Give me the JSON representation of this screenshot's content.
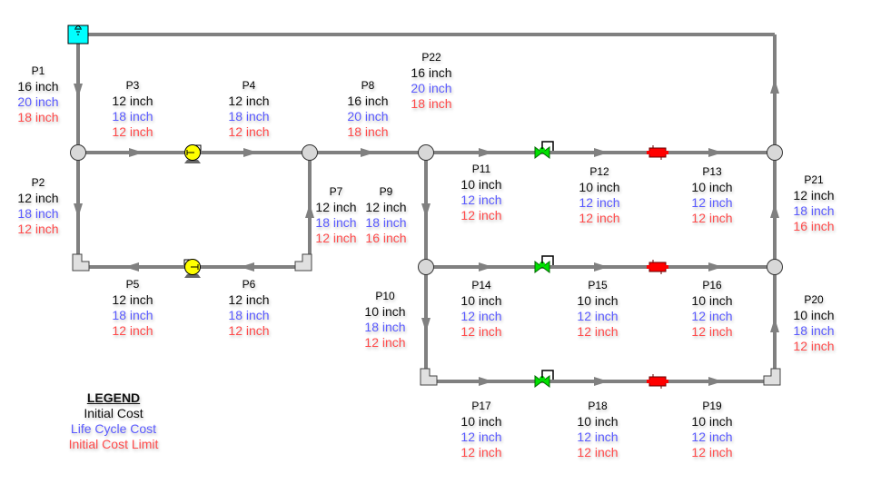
{
  "colors": {
    "pipe": "#808080",
    "initial_cost": "#111111",
    "life_cycle_cost": "#5a5aff",
    "initial_cost_limit": "#ff4a4a",
    "tank": "#00ffff",
    "pump": "#ffff00",
    "valve": "#00e000",
    "heat_exchanger": "#ff0000",
    "junction": "#d8d8d8"
  },
  "pipes": [
    {
      "name": "P1",
      "initial": "16 inch",
      "lcc": "20 inch",
      "limit": "18 inch"
    },
    {
      "name": "P2",
      "initial": "12 inch",
      "lcc": "18 inch",
      "limit": "12 inch"
    },
    {
      "name": "P3",
      "initial": "12 inch",
      "lcc": "18 inch",
      "limit": "12 inch"
    },
    {
      "name": "P4",
      "initial": "12 inch",
      "lcc": "18 inch",
      "limit": "12 inch"
    },
    {
      "name": "P5",
      "initial": "12 inch",
      "lcc": "18 inch",
      "limit": "12 inch"
    },
    {
      "name": "P6",
      "initial": "12 inch",
      "lcc": "18 inch",
      "limit": "12 inch"
    },
    {
      "name": "P7",
      "initial": "12 inch",
      "lcc": "18 inch",
      "limit": "12 inch"
    },
    {
      "name": "P8",
      "initial": "16 inch",
      "lcc": "20 inch",
      "limit": "18 inch"
    },
    {
      "name": "P9",
      "initial": "12 inch",
      "lcc": "18 inch",
      "limit": "16 inch"
    },
    {
      "name": "P10",
      "initial": "10 inch",
      "lcc": "18 inch",
      "limit": "12 inch"
    },
    {
      "name": "P11",
      "initial": "10 inch",
      "lcc": "12 inch",
      "limit": "12 inch"
    },
    {
      "name": "P12",
      "initial": "10 inch",
      "lcc": "12 inch",
      "limit": "12 inch"
    },
    {
      "name": "P13",
      "initial": "10 inch",
      "lcc": "12 inch",
      "limit": "12 inch"
    },
    {
      "name": "P14",
      "initial": "10 inch",
      "lcc": "12 inch",
      "limit": "12 inch"
    },
    {
      "name": "P15",
      "initial": "10 inch",
      "lcc": "12 inch",
      "limit": "12 inch"
    },
    {
      "name": "P16",
      "initial": "10 inch",
      "lcc": "12 inch",
      "limit": "12 inch"
    },
    {
      "name": "P17",
      "initial": "10 inch",
      "lcc": "12 inch",
      "limit": "12 inch"
    },
    {
      "name": "P18",
      "initial": "10 inch",
      "lcc": "12 inch",
      "limit": "12 inch"
    },
    {
      "name": "P19",
      "initial": "10 inch",
      "lcc": "12 inch",
      "limit": "12 inch"
    },
    {
      "name": "P20",
      "initial": "10 inch",
      "lcc": "18 inch",
      "limit": "12 inch"
    },
    {
      "name": "P21",
      "initial": "12 inch",
      "lcc": "18 inch",
      "limit": "16 inch"
    },
    {
      "name": "P22",
      "initial": "16 inch",
      "lcc": "20 inch",
      "limit": "18 inch"
    }
  ],
  "legend": {
    "title": "LEGEND",
    "items": [
      "Initial Cost",
      "Life Cycle Cost",
      "Initial Cost Limit"
    ]
  }
}
